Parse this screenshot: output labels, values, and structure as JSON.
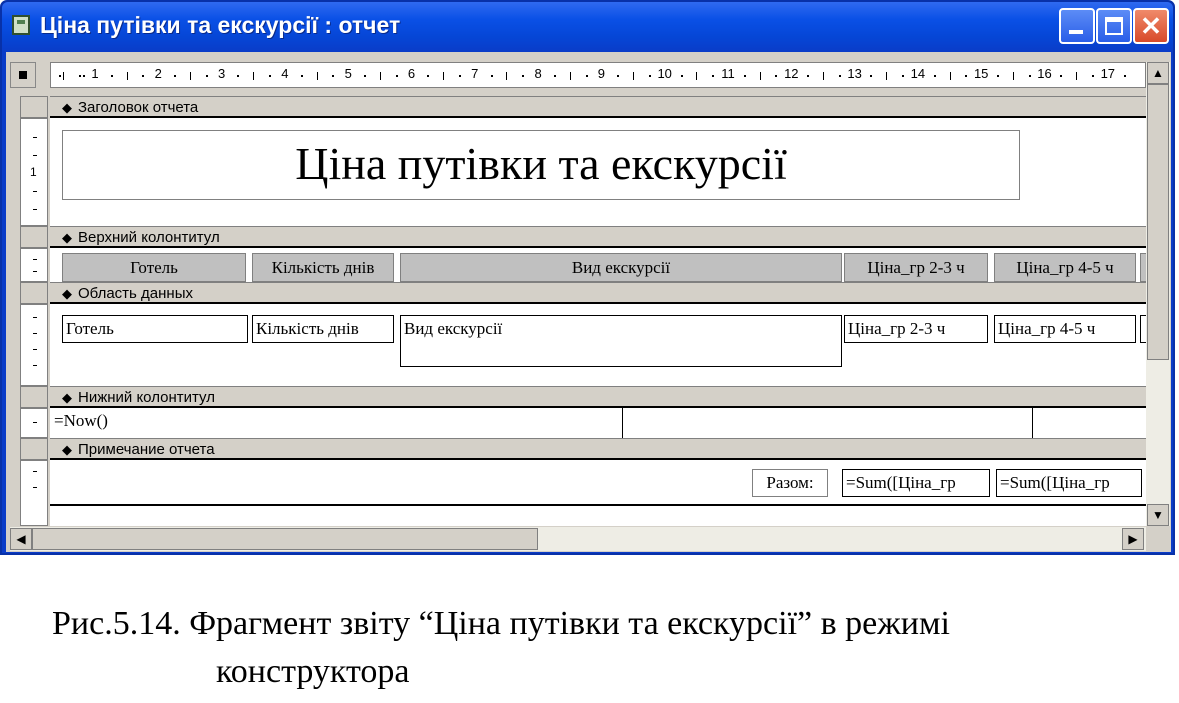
{
  "window": {
    "title": "Ціна путівки та екскурсії : отчет",
    "close_glyph": "✕"
  },
  "ruler": {
    "numbers": [
      "1",
      "2",
      "3",
      "4",
      "5",
      "6",
      "7",
      "8",
      "9",
      "10",
      "11",
      "12",
      "13",
      "14",
      "15",
      "16",
      "17"
    ]
  },
  "vruler": {
    "mark": "1"
  },
  "sections": {
    "report_header": "Заголовок отчета",
    "page_header": "Верхний колонтитул",
    "detail": "Область данных",
    "page_footer": "Нижний колонтитул",
    "report_footer": "Примечание отчета"
  },
  "report_title": "Ціна путівки та екскурсії",
  "page_header_labels": [
    "Готель",
    "Кількість днів",
    "Вид екскурсії",
    "Ціна_гр 2-3 ч",
    "Ціна_гр 4-5 ч"
  ],
  "detail_fields": [
    "Готель",
    "Кількість днів",
    "Вид екскурсії",
    "Ціна_гр 2-3 ч",
    "Ціна_гр 4-5 ч"
  ],
  "page_footer_field": "=Now()",
  "report_footer": {
    "label": "Разом:",
    "sum1": "=Sum([Ціна_гр",
    "sum2": "=Sum([Ціна_гр"
  },
  "caption": {
    "line1": "Рис.5.14. Фрагмент звіту “Ціна путівки та екскурсії” в режимі",
    "line2": "конструктора"
  }
}
